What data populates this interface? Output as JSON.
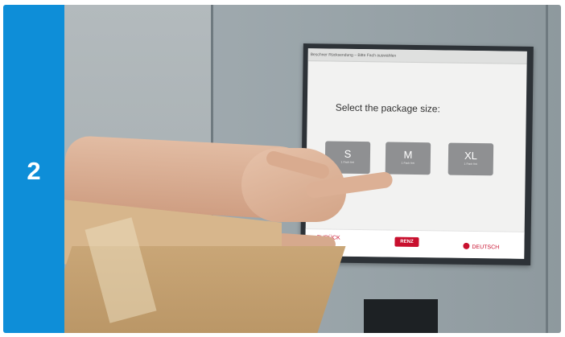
{
  "step": {
    "number": "2",
    "color": "#0e8ed8"
  },
  "kiosk": {
    "header": "Beschner Rücksendung – Bitte Fach auswählen",
    "prompt": "Select the package size:",
    "sizes": [
      {
        "label": "S",
        "sub": "1 Fach frei"
      },
      {
        "label": "M",
        "sub": "1 Fach frei"
      },
      {
        "label": "XL",
        "sub": "1 Fach frei"
      }
    ],
    "back_label": "< ZURÜCK",
    "logo": "RENZ",
    "language_label": "DEUTSCH",
    "accent_color": "#c8102e"
  }
}
